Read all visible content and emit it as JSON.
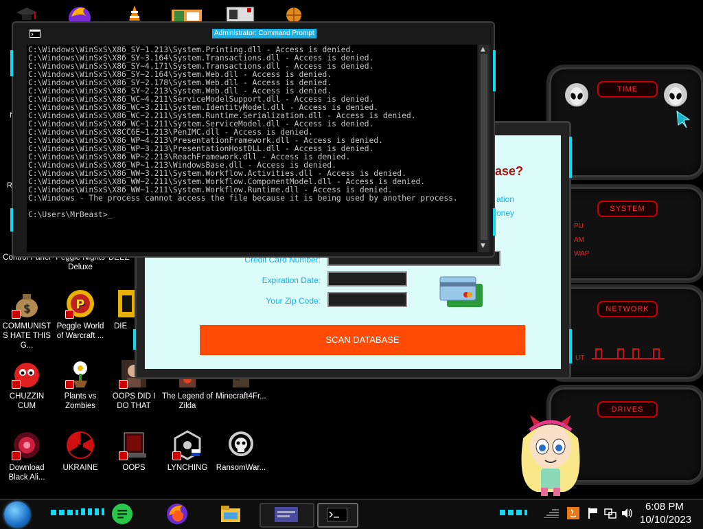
{
  "cmd": {
    "title": "Administrator: Command Prompt",
    "lines": [
      "C:\\Windows\\WinSxS\\X86_SY~1.213\\System.Printing.dll - Access is denied.",
      "C:\\Windows\\WinSxS\\X86_SY~3.164\\System.Transactions.dll - Access is denied.",
      "C:\\Windows\\WinSxS\\X86_SY~4.171\\System.Transactions.dll - Access is denied.",
      "C:\\Windows\\WinSxS\\X86_SY~2.164\\System.Web.dll - Access is denied.",
      "C:\\Windows\\WinSxS\\X86_SY~2.178\\System.Web.dll - Access is denied.",
      "C:\\Windows\\WinSxS\\X86_SY~2.213\\System.Web.dll - Access is denied.",
      "C:\\Windows\\WinSxS\\X86_WC~4.211\\ServiceModelSupport.dll - Access is denied.",
      "C:\\Windows\\WinSxS\\X86_WC~3.211\\System.IdentityModel.dll - Access is denied.",
      "C:\\Windows\\WinSxS\\X86_WC~2.211\\System.Runtime.Serialization.dll - Access is denied.",
      "C:\\Windows\\WinSxS\\X86_WC~1.211\\System.ServiceModel.dll - Access is denied.",
      "C:\\Windows\\WinSxS\\X8CC6E~1.213\\PenIMC.dll - Access is denied.",
      "C:\\Windows\\WinSxS\\X86_WP~4.213\\PresentationFramework.dll - Access is denied.",
      "C:\\Windows\\WinSxS\\X86_WP~3.213\\PresentationHostDLL.dll - Access is denied.",
      "C:\\Windows\\WinSxS\\X86_WP~2.213\\ReachFramework.dll - Access is denied.",
      "C:\\Windows\\WinSxS\\X86_WP~1.213\\WindowsBase.dll - Access is denied.",
      "C:\\Windows\\WinSxS\\X86_WW~3.211\\System.Workflow.Activities.dll - Access is denied.",
      "C:\\Windows\\WinSxS\\X86_WW~2.211\\System.Workflow.ComponentModel.dll - Access is denied.",
      "C:\\Windows\\WinSxS\\X86_WW~1.211\\System.Workflow.Runtime.dll - Access is denied.",
      "C:\\Windows - The process cannot access the file because it is being used by another process.",
      "",
      "C:\\Users\\MrBeast>_"
    ]
  },
  "form": {
    "heading_fragment": "ase?",
    "side_text_1": "ation",
    "side_text_2": "oney",
    "card_number_label": "Credit Card Number:",
    "expiration_label": "Expiration Date:",
    "zip_label": "Your Zip Code:",
    "scan_button": "SCAN DATABASE"
  },
  "desktop_icons": {
    "control_panel": "Control Panel",
    "peggle_nights": "Peggle Nights Deluxe",
    "deez": "DEEZ",
    "communists": "COMMUNISTS HATE THIS G...",
    "peggle_world": "Peggle World of Warcraft ...",
    "die": "DIE",
    "chuzzin": "CHUZZIN CUM",
    "plants": "Plants vs Zombies",
    "oops_did": "OOPS DID I DO THAT",
    "zilda": "The Legend of Zilda",
    "minecraft": "Minecraft4Fr...",
    "download": "Download Black Ali...",
    "ukraine": "UKRAINE",
    "oops": "OOPS",
    "lynching": "LYNCHING",
    "ransomware": "RansomWar...",
    "left_n": "N",
    "left_re": "Re"
  },
  "gadgets": {
    "time": "TIME",
    "system": "SYSTEM",
    "network": "NETWORK",
    "drives": "DRIVES",
    "cpu": "PU",
    "ram": "AM",
    "swap": "WAP",
    "net_out": "UT"
  },
  "tray": {
    "time": "6:08 PM",
    "date": "10/10/2023"
  },
  "colors": {
    "accent_cyan": "#17d6f0",
    "button_orange": "#ff4b05",
    "gadget_red": "#ff2020",
    "form_bg": "#dcfcfa"
  }
}
